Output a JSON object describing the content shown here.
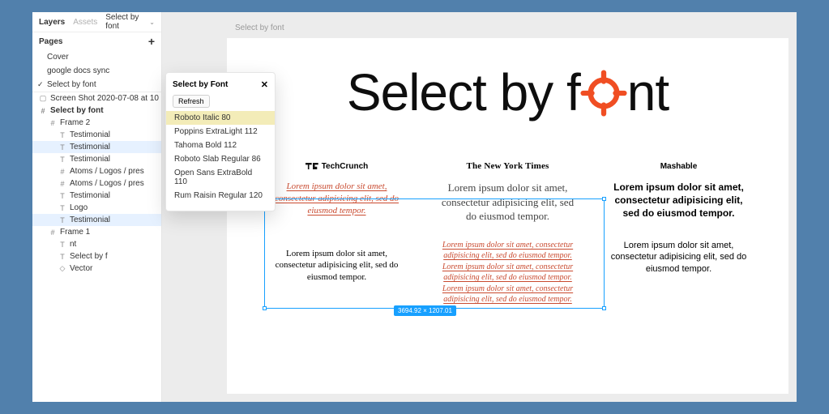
{
  "tabs": {
    "layers": "Layers",
    "assets": "Assets",
    "plugin": "Select by font"
  },
  "pages": {
    "header": "Pages",
    "items": [
      "Cover",
      "google docs sync",
      "Select by font"
    ],
    "selected": 2
  },
  "layers": [
    {
      "icon": "image",
      "label": "Screen Shot 2020-07-08 at 10",
      "depth": 0
    },
    {
      "icon": "frame",
      "label": "Select by font",
      "depth": 0,
      "bold": true
    },
    {
      "icon": "frame",
      "label": "Frame 2",
      "depth": 1
    },
    {
      "icon": "text",
      "label": "Testimonial",
      "depth": 2
    },
    {
      "icon": "text",
      "label": "Testimonial",
      "depth": 2,
      "hl": true
    },
    {
      "icon": "text",
      "label": "Testimonial",
      "depth": 2
    },
    {
      "icon": "frame",
      "label": "Atoms / Logos / pres",
      "depth": 2
    },
    {
      "icon": "frame",
      "label": "Atoms / Logos / pres",
      "depth": 2
    },
    {
      "icon": "text",
      "label": "Testimonial",
      "depth": 2
    },
    {
      "icon": "text",
      "label": "Logo",
      "depth": 2
    },
    {
      "icon": "text",
      "label": "Testimonial",
      "depth": 2,
      "hl": true
    },
    {
      "icon": "frame",
      "label": "Frame 1",
      "depth": 1
    },
    {
      "icon": "text",
      "label": "nt",
      "depth": 2
    },
    {
      "icon": "text",
      "label": "Select by f",
      "depth": 2
    },
    {
      "icon": "vector",
      "label": "Vector",
      "depth": 2
    }
  ],
  "fontPanel": {
    "title": "Select by Font",
    "refresh": "Refresh",
    "items": [
      "Roboto Italic 80",
      "Poppins ExtraLight 112",
      "Tahoma Bold 112",
      "Roboto Slab Regular 86",
      "Open Sans ExtraBold 110",
      "Rum Raisin Regular 120"
    ],
    "selected": 0
  },
  "canvas": {
    "crumb": "Select by font",
    "hero_a": "Select by f",
    "hero_b": "nt",
    "brands": {
      "tc": "TechCrunch",
      "nyt": "The New York Times",
      "mash": "Mashable"
    },
    "lorem_short": "Lorem ipsum dolor sit amet, consectetur adipisicing elit, sed do eiusmod tempor.",
    "lorem_serif": "Lorem ipsum dolor sit amet, consectetur adipisicing elit, sed do eiusmod tempor.",
    "lorem_bold": "Lorem ipsum dolor sit amet, consectetur adipisicing elit, sed do eiusmod tempor.",
    "lorem_plain": "Lorem ipsum dolor sit amet, consectetur adipisicing elit, sed do eiusmod tempor.",
    "lorem_red2": "Lorem ipsum dolor sit amet, consectetur adipisicing elit, sed do eiusmod tempor. Lorem ipsum dolor sit amet, consectetur adipisicing elit, sed do eiusmod tempor. Lorem ipsum dolor sit amet, consectetur adipisicing elit, sed do eiusmod tempor.",
    "lorem_cond": "Lorem ipsum dolor sit amet, consectetur adipisicing elit, sed do eiusmod tempor.",
    "dim": "3694.92 × 1207.01"
  }
}
